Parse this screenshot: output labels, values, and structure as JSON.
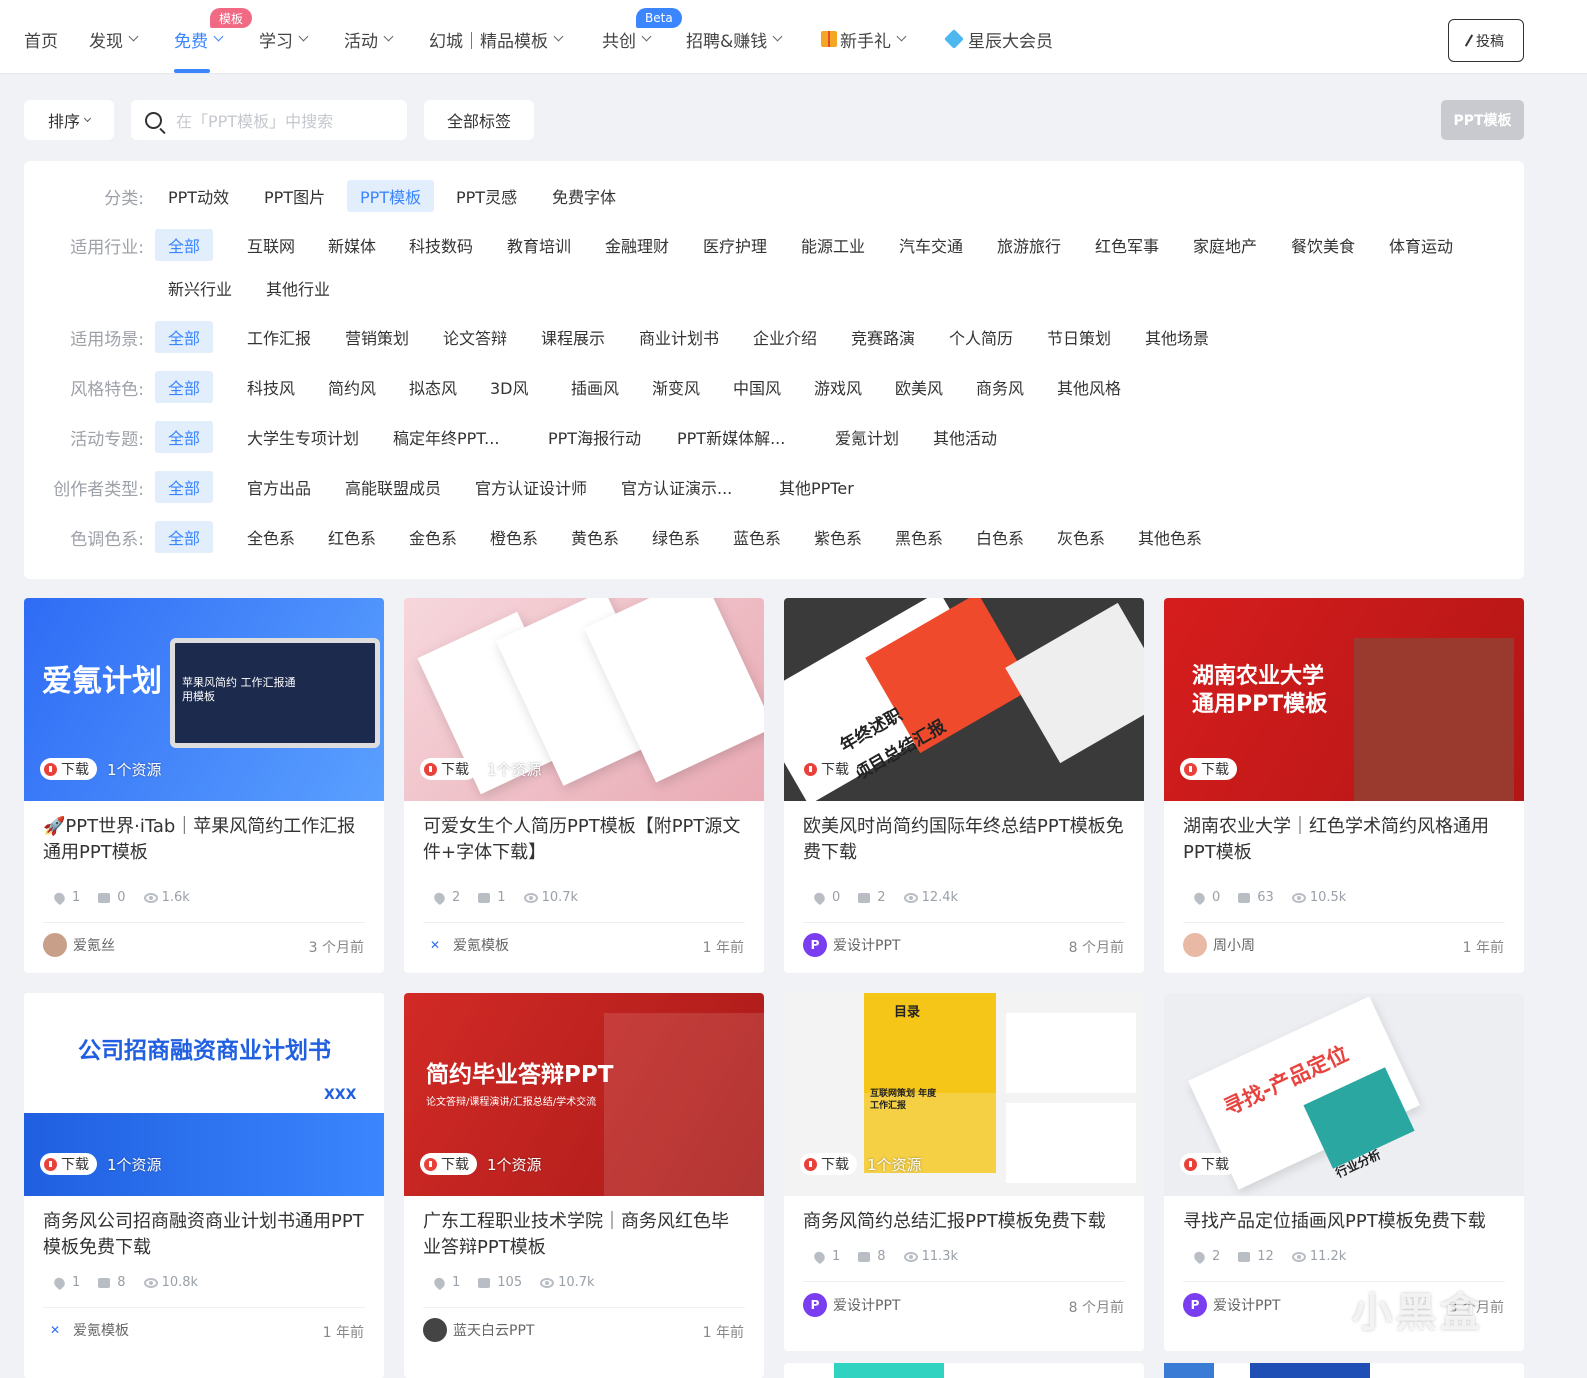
{
  "nav": {
    "items": [
      "首页",
      "发现",
      "免费",
      "学习",
      "活动",
      "幻城｜精品模板",
      "共创",
      "招聘&赚钱",
      "新手礼",
      "星辰大会员"
    ],
    "badge_free": "模板",
    "badge_cocreate": "Beta",
    "submit": "投稿"
  },
  "toolbar": {
    "sort": "排序",
    "search_placeholder": "在「PPT模板」中搜索",
    "all_tags": "全部标签",
    "ppt_button": "PPT模板"
  },
  "filters": {
    "category_label": "分类:",
    "category": [
      "PPT动效",
      "PPT图片",
      "PPT模板",
      "PPT灵感",
      "免费字体"
    ],
    "industry_label": "适用行业:",
    "industry": [
      "全部",
      "互联网",
      "新媒体",
      "科技数码",
      "教育培训",
      "金融理财",
      "医疗护理",
      "能源工业",
      "汽车交通",
      "旅游旅行",
      "红色军事",
      "家庭地产",
      "餐饮美食",
      "体育运动",
      "新兴行业",
      "其他行业"
    ],
    "scene_label": "适用场景:",
    "scene": [
      "全部",
      "工作汇报",
      "营销策划",
      "论文答辩",
      "课程展示",
      "商业计划书",
      "企业介绍",
      "竞赛路演",
      "个人简历",
      "节日策划",
      "其他场景"
    ],
    "style_label": "风格特色:",
    "style": [
      "全部",
      "科技风",
      "简约风",
      "拟态风",
      "3D风",
      "插画风",
      "渐变风",
      "中国风",
      "游戏风",
      "欧美风",
      "商务风",
      "其他风格"
    ],
    "topic_label": "活动专题:",
    "topic": [
      "全部",
      "大学生专项计划",
      "稿定年终PPT...",
      "PPT海报行动",
      "PPT新媒体解...",
      "爱氪计划",
      "其他活动"
    ],
    "creator_label": "创作者类型:",
    "creator": [
      "全部",
      "官方出品",
      "高能联盟成员",
      "官方认证设计师",
      "官方认证演示...",
      "其他PPTer"
    ],
    "color_label": "色调色系:",
    "color": [
      "全部",
      "全色系",
      "红色系",
      "金色系",
      "橙色系",
      "黄色系",
      "绿色系",
      "蓝色系",
      "紫色系",
      "黑色系",
      "白色系",
      "灰色系",
      "其他色系"
    ]
  },
  "download_label": "下载",
  "resource_label": "1个资源",
  "cards": [
    {
      "title": "🚀PPT世界·iTab｜苹果风简约工作汇报通用PPT模板",
      "likes": "1",
      "comments": "0",
      "views": "1.6k",
      "author": "爱氪丝",
      "time": "3 个月前",
      "thumb_text": "爱氪计划",
      "thumb_sub": "苹果风简约 工作汇报通用模板",
      "color": "#2f6cf5"
    },
    {
      "title": "可爱女生个人简历PPT模板【附PPT源文件+字体下载】",
      "likes": "2",
      "comments": "1",
      "views": "10.7k",
      "author": "爱氪模板",
      "time": "1 年前",
      "thumb_text": "",
      "thumb_sub": "",
      "color": "#f2c6cc"
    },
    {
      "title": "欧美风时尚简约国际年终总结PPT模板免费下载",
      "likes": "0",
      "comments": "2",
      "views": "12.4k",
      "author": "爱设计PPT",
      "time": "8 个月前",
      "thumb_text": "年终述职",
      "thumb_sub": "项目总结汇报",
      "color": "#3a3a3a"
    },
    {
      "title": "湖南农业大学｜红色学术简约风格通用PPT模板",
      "likes": "0",
      "comments": "63",
      "views": "10.5k",
      "author": "周小周",
      "time": "1 年前",
      "thumb_text": "湖南农业大学",
      "thumb_sub": "通用PPT模板",
      "color": "#c9201f"
    },
    {
      "title": "商务风公司招商融资商业计划书通用PPT模板免费下载",
      "likes": "1",
      "comments": "8",
      "views": "10.8k",
      "author": "爱氪模板",
      "time": "1 年前",
      "thumb_text": "公司招商融资商业计划书",
      "thumb_sub": "XXX",
      "color": "#1f5fe0"
    },
    {
      "title": "广东工程职业技术学院｜商务风红色毕业答辩PPT模板",
      "likes": "1",
      "comments": "105",
      "views": "10.7k",
      "author": "蓝天白云PPT",
      "time": "1 年前",
      "thumb_text": "简约毕业答辩PPT",
      "thumb_sub": "论文答辩/课程演讲/汇报总结/学术交流",
      "color": "#c42322"
    },
    {
      "title": "商务风简约总结汇报PPT模板免费下载",
      "likes": "1",
      "comments": "8",
      "views": "11.3k",
      "author": "爱设计PPT",
      "time": "8 个月前",
      "thumb_text": "目录",
      "thumb_sub": "互联网策划 年度工作汇报",
      "color": "#f5c518"
    },
    {
      "title": "寻找产品定位插画风PPT模板免费下载",
      "likes": "2",
      "comments": "12",
      "views": "11.2k",
      "author": "爱设计PPT",
      "time": "3 个月前",
      "thumb_text": "寻找-产品定位",
      "thumb_sub": "行业分析",
      "color": "#e8443f"
    }
  ],
  "watermark": "小黑盒"
}
